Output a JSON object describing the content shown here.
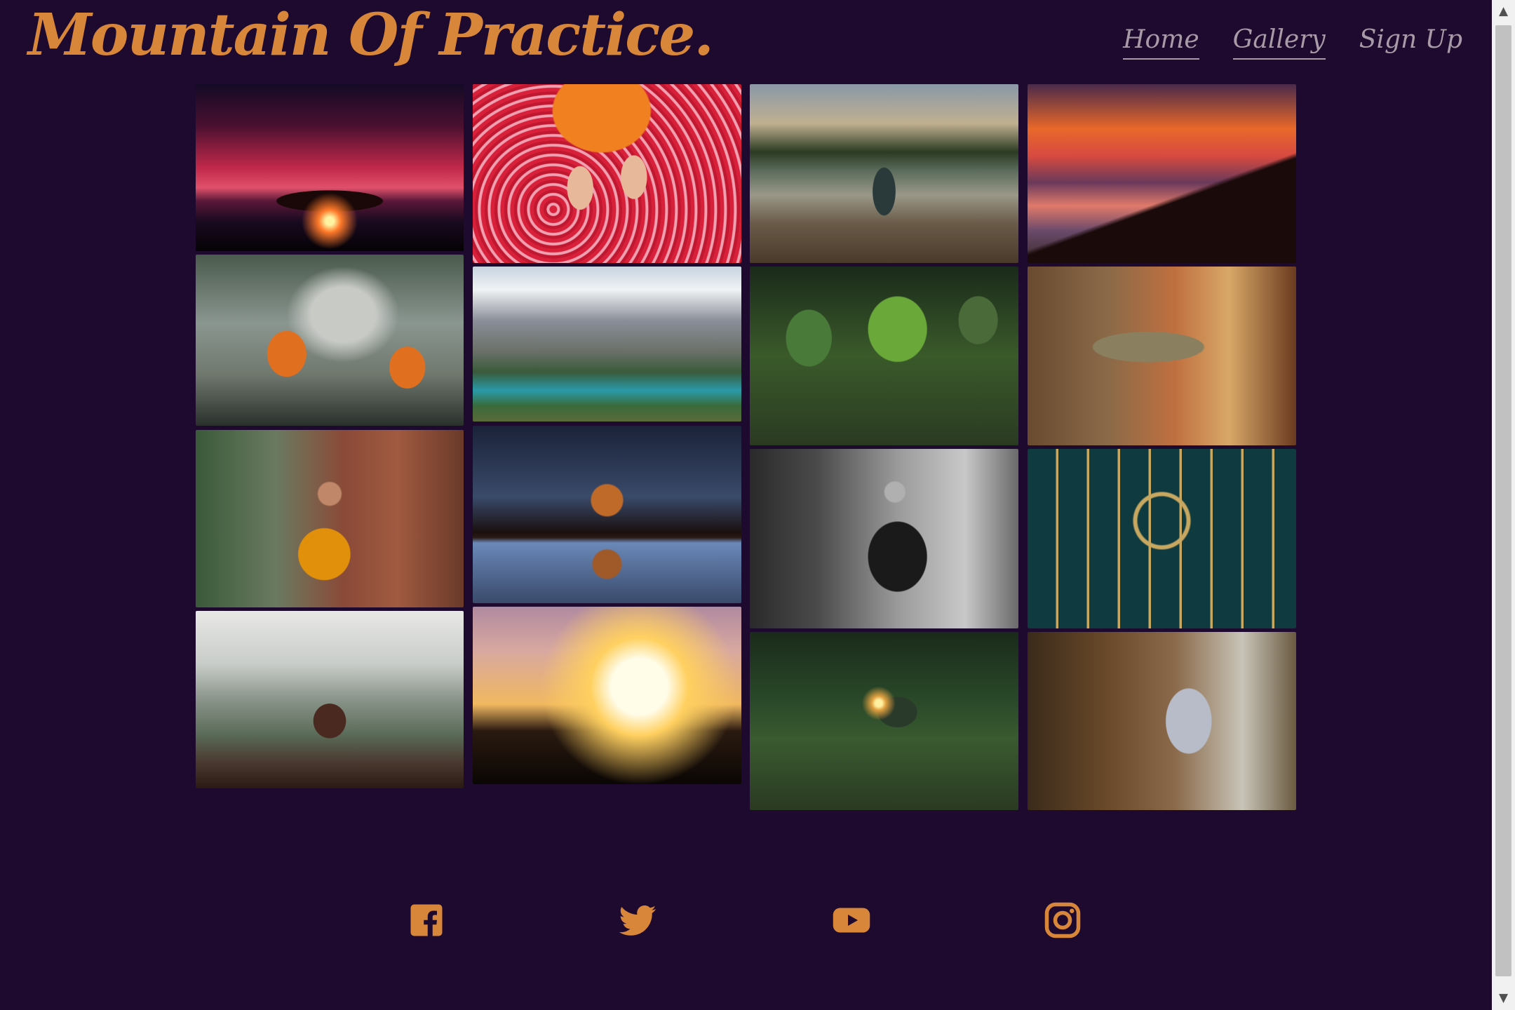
{
  "header": {
    "logo": "Mountain Of Practice."
  },
  "nav": [
    {
      "label": "Home",
      "active": true
    },
    {
      "label": "Gallery",
      "active": true
    },
    {
      "label": "Sign Up",
      "active": false
    }
  ],
  "gallery": {
    "images": [
      {
        "name": "red-sky-tree-sunset"
      },
      {
        "name": "monk-walking-rose-petals"
      },
      {
        "name": "woman-meditating-on-dock"
      },
      {
        "name": "lake-sunset-mountains"
      },
      {
        "name": "young-monks-splashing-water"
      },
      {
        "name": "alpine-lake-mountains"
      },
      {
        "name": "moss-covered-buddha-statues"
      },
      {
        "name": "bronze-hand-fountain"
      },
      {
        "name": "monk-meditating-ruins"
      },
      {
        "name": "tree-reflection-night"
      },
      {
        "name": "man-praying-meditation"
      },
      {
        "name": "yin-yang-gate"
      },
      {
        "name": "woman-meditating-on-rock"
      },
      {
        "name": "woman-silhouette-sunset"
      },
      {
        "name": "boy-with-lantern-in-field"
      },
      {
        "name": "buddha-statue-doorway"
      }
    ]
  },
  "social": [
    {
      "icon": "facebook-icon"
    },
    {
      "icon": "twitter-icon"
    },
    {
      "icon": "youtube-icon"
    },
    {
      "icon": "instagram-icon"
    }
  ],
  "colors": {
    "background": "#1d0a2e",
    "accent": "#d8863a",
    "nav_text": "#a89aa6"
  }
}
